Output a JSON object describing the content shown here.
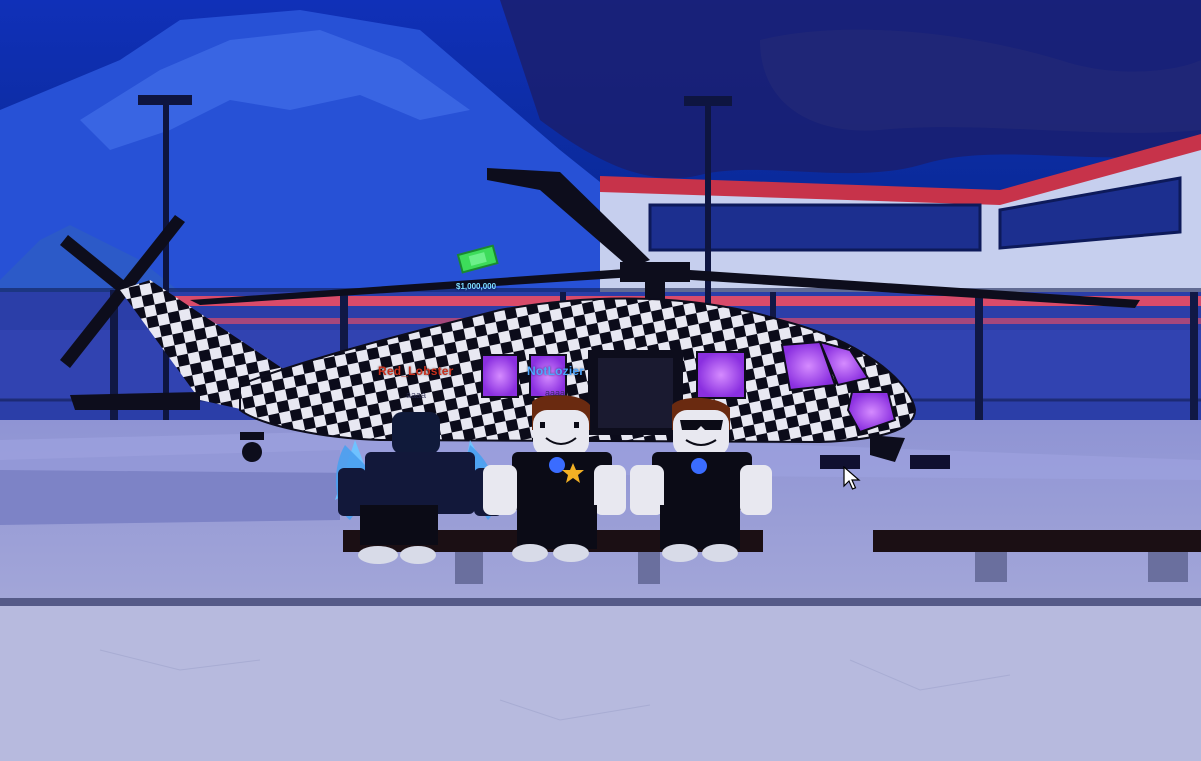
{
  "vehicle": {
    "price_label": "$1,000,000",
    "pattern": "checkered",
    "window_glow_color": "#b052ff"
  },
  "players": [
    {
      "name": "Red_Lobster",
      "chat": "aaaa",
      "name_color": "#c8301e"
    },
    {
      "name": "NotLozier",
      "chat": "aaaa",
      "name_color": "#4da6ff"
    }
  ],
  "colors": {
    "sky": "#0d2fa8",
    "building_stripe": "#c8344a",
    "ground": "#a9aed8",
    "money_icon": "#3ddc5a"
  },
  "icons": [
    "money-icon",
    "mouse-cursor-icon",
    "sheriff-badge-icon",
    "sunglasses-icon",
    "wings-icon"
  ]
}
